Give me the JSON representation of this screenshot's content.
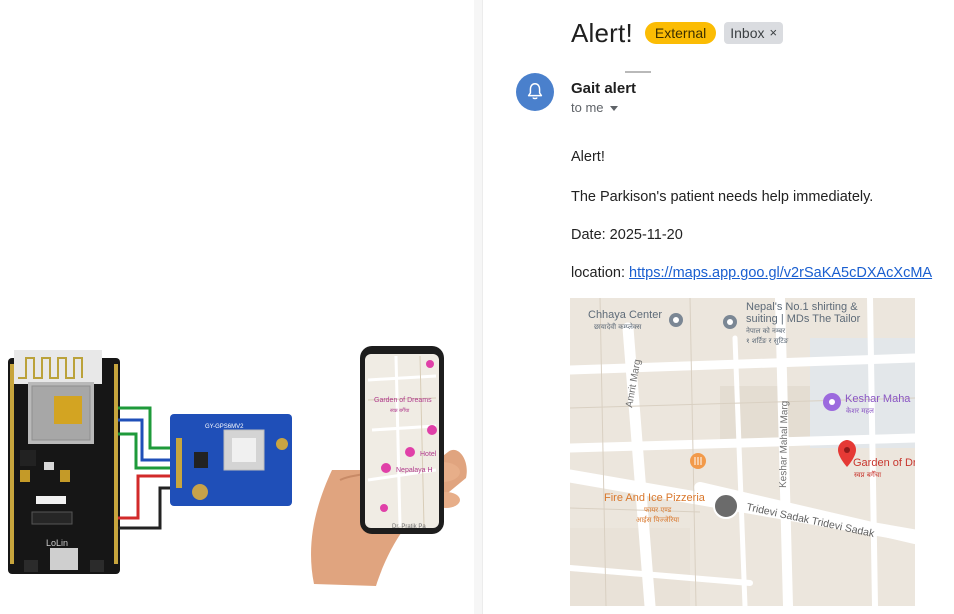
{
  "email": {
    "subject": "Alert!",
    "labels": {
      "external": "External",
      "inbox": "Inbox",
      "inbox_remove": "×"
    },
    "sender": "Gait alert",
    "recipient": "to me",
    "body": {
      "greeting": "Alert!",
      "message": "The Parkison's patient needs help immediately.",
      "date": "Date: 2025-11-20",
      "location_label": "location: ",
      "location_link": "https://maps.app.goo.gl/v2rSaKA5cDXAcXcMA"
    }
  },
  "map": {
    "places": {
      "chhaya_center": "Chhaya Center",
      "chhaya_center_np": "छायादेवी कम्प्लेक्स",
      "nepal_shirting_1": "Nepal's No.1 shirting &",
      "nepal_shirting_2": "suiting | MDs The Tailor",
      "nepal_shirting_np1": "नेपाल को नम्बर",
      "nepal_shirting_np2": "१ शर्टिङ र सुटिङ",
      "amrit_marg": "Amrit Marg",
      "keshar_mahal_marg": "Keshar Mahal Marg",
      "keshar_mahal": "Keshar Maha",
      "keshar_mahal_np": "केशर महल",
      "garden_of_dreams": "Garden of Dr",
      "garden_of_dreams_np": "स्वप्न बगैँचा",
      "fire_and_ice": "Fire And Ice Pizzeria",
      "fire_and_ice_np1": "फायर एण्ड",
      "fire_and_ice_np2": "आईस पिज्जेरिया",
      "tridevi_sadak": "Tridevi Sadak Tridevi Sadak"
    }
  },
  "illustration": {
    "phone_labels": {
      "garden": "Garden of Dreams",
      "garden_np": "स्वप्न बगैँचा",
      "hotel": "Hotel",
      "nepalaya": "Nepalaya H",
      "pratik": "Dr. Pratik Pa"
    },
    "gps_module_label": "GY-GPS6MV2",
    "board_label": "LoLin"
  },
  "colors": {
    "external_chip": "#fbbc04",
    "inbox_chip": "#dadce0",
    "link": "#1a5fd0",
    "avatar": "#4a80cc",
    "map_pin": "#e53935",
    "map_poi": "#9c6ade",
    "gps_board": "#1f4fb8"
  }
}
